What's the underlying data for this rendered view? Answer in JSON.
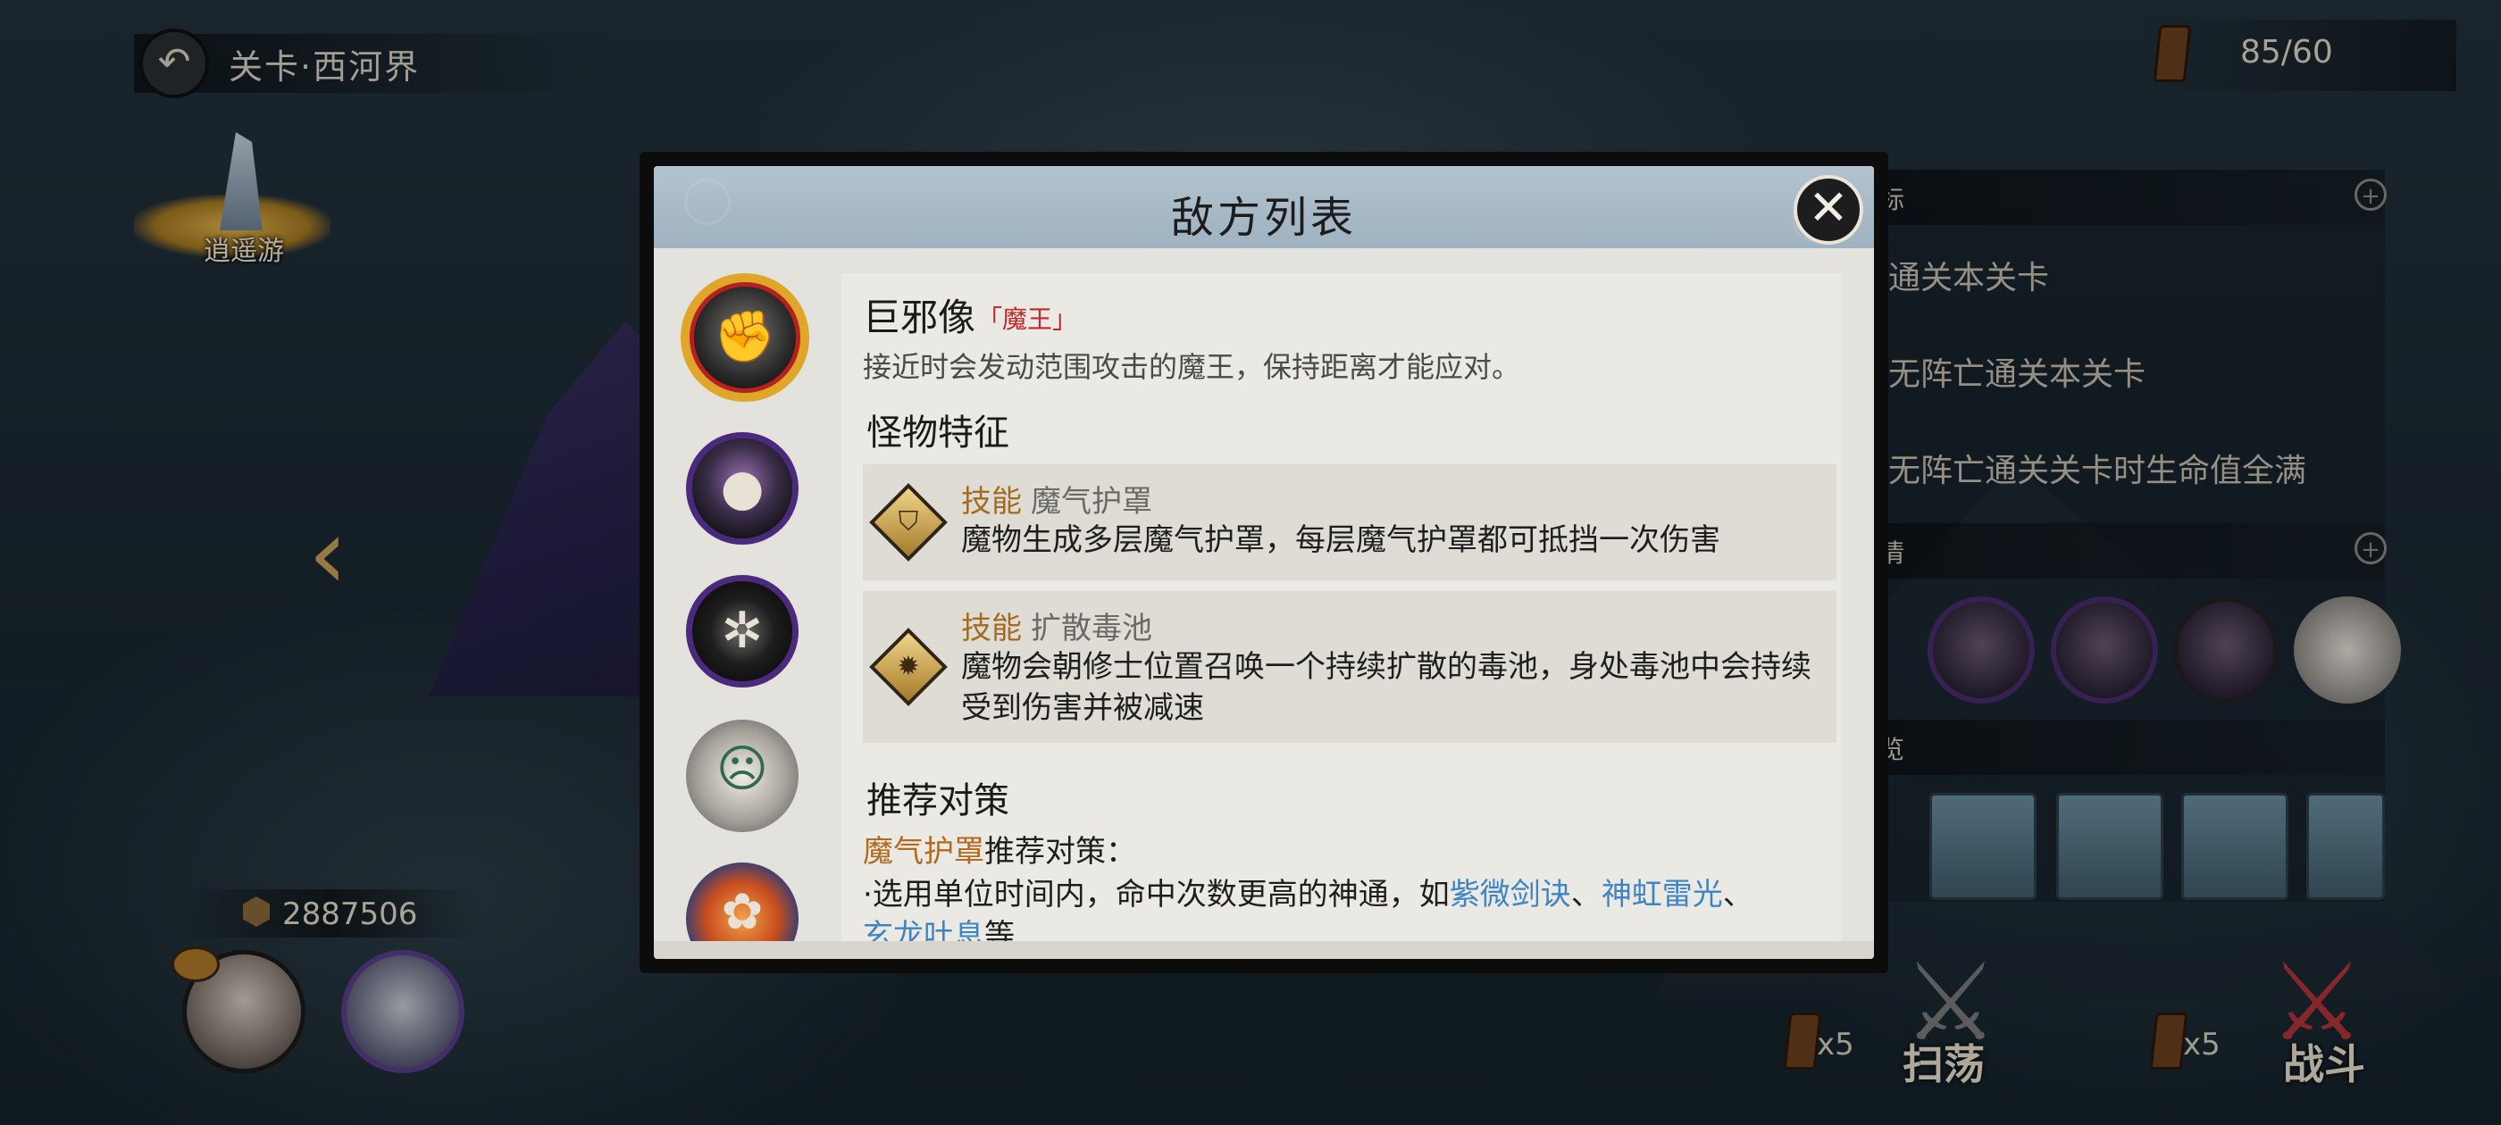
{
  "hud": {
    "stage_title": "关卡·西河界",
    "stamina": "85/60",
    "hero_name": "逍遥游",
    "power": "2887506"
  },
  "right_panel": {
    "objectives_header": "标",
    "objectives": [
      "通关本关卡",
      "无阵亡通关本关卡",
      "无阵亡通关关卡时生命值全满"
    ],
    "enemies_header": "情",
    "rewards_header": "览"
  },
  "actions": {
    "sweep_cost": "x5",
    "sweep_label": "扫荡",
    "battle_cost": "x5",
    "battle_label": "战斗"
  },
  "dialog": {
    "title": "敌方列表",
    "enemy": {
      "name": "巨邪像",
      "tag": "「魔王」",
      "description": "接近时会发动范围攻击的魔王，保持距离才能应对。"
    },
    "traits_heading": "怪物特征",
    "skills": [
      {
        "type": "技能",
        "name": "魔气护罩",
        "desc": "魔物生成多层魔气护罩，每层魔气护罩都可抵挡一次伤害",
        "icon": "shield-icon"
      },
      {
        "type": "技能",
        "name": "扩散毒池",
        "desc": "魔物会朝修士位置召唤一个持续扩散的毒池，身处毒池中会持续受到伤害并被减速",
        "icon": "burst-icon"
      }
    ],
    "strategy_heading": "推荐对策",
    "strategy": {
      "skill_ref": "魔气护罩",
      "suffix": "推荐对策：",
      "line_prefix": "·选用单位时间内，命中次数更高的神通，如",
      "spell1": "紫微剑诀",
      "sep1": "、",
      "spell2": "神虹雷光",
      "sep2": "、",
      "spell3": "玄龙吐息",
      "end": "等"
    }
  },
  "colors": {
    "boss_ring": "#e0a62a",
    "boss_tag": "#c0282d",
    "skill_type": "#a36b1f",
    "spell_link": "#3f85c2"
  }
}
